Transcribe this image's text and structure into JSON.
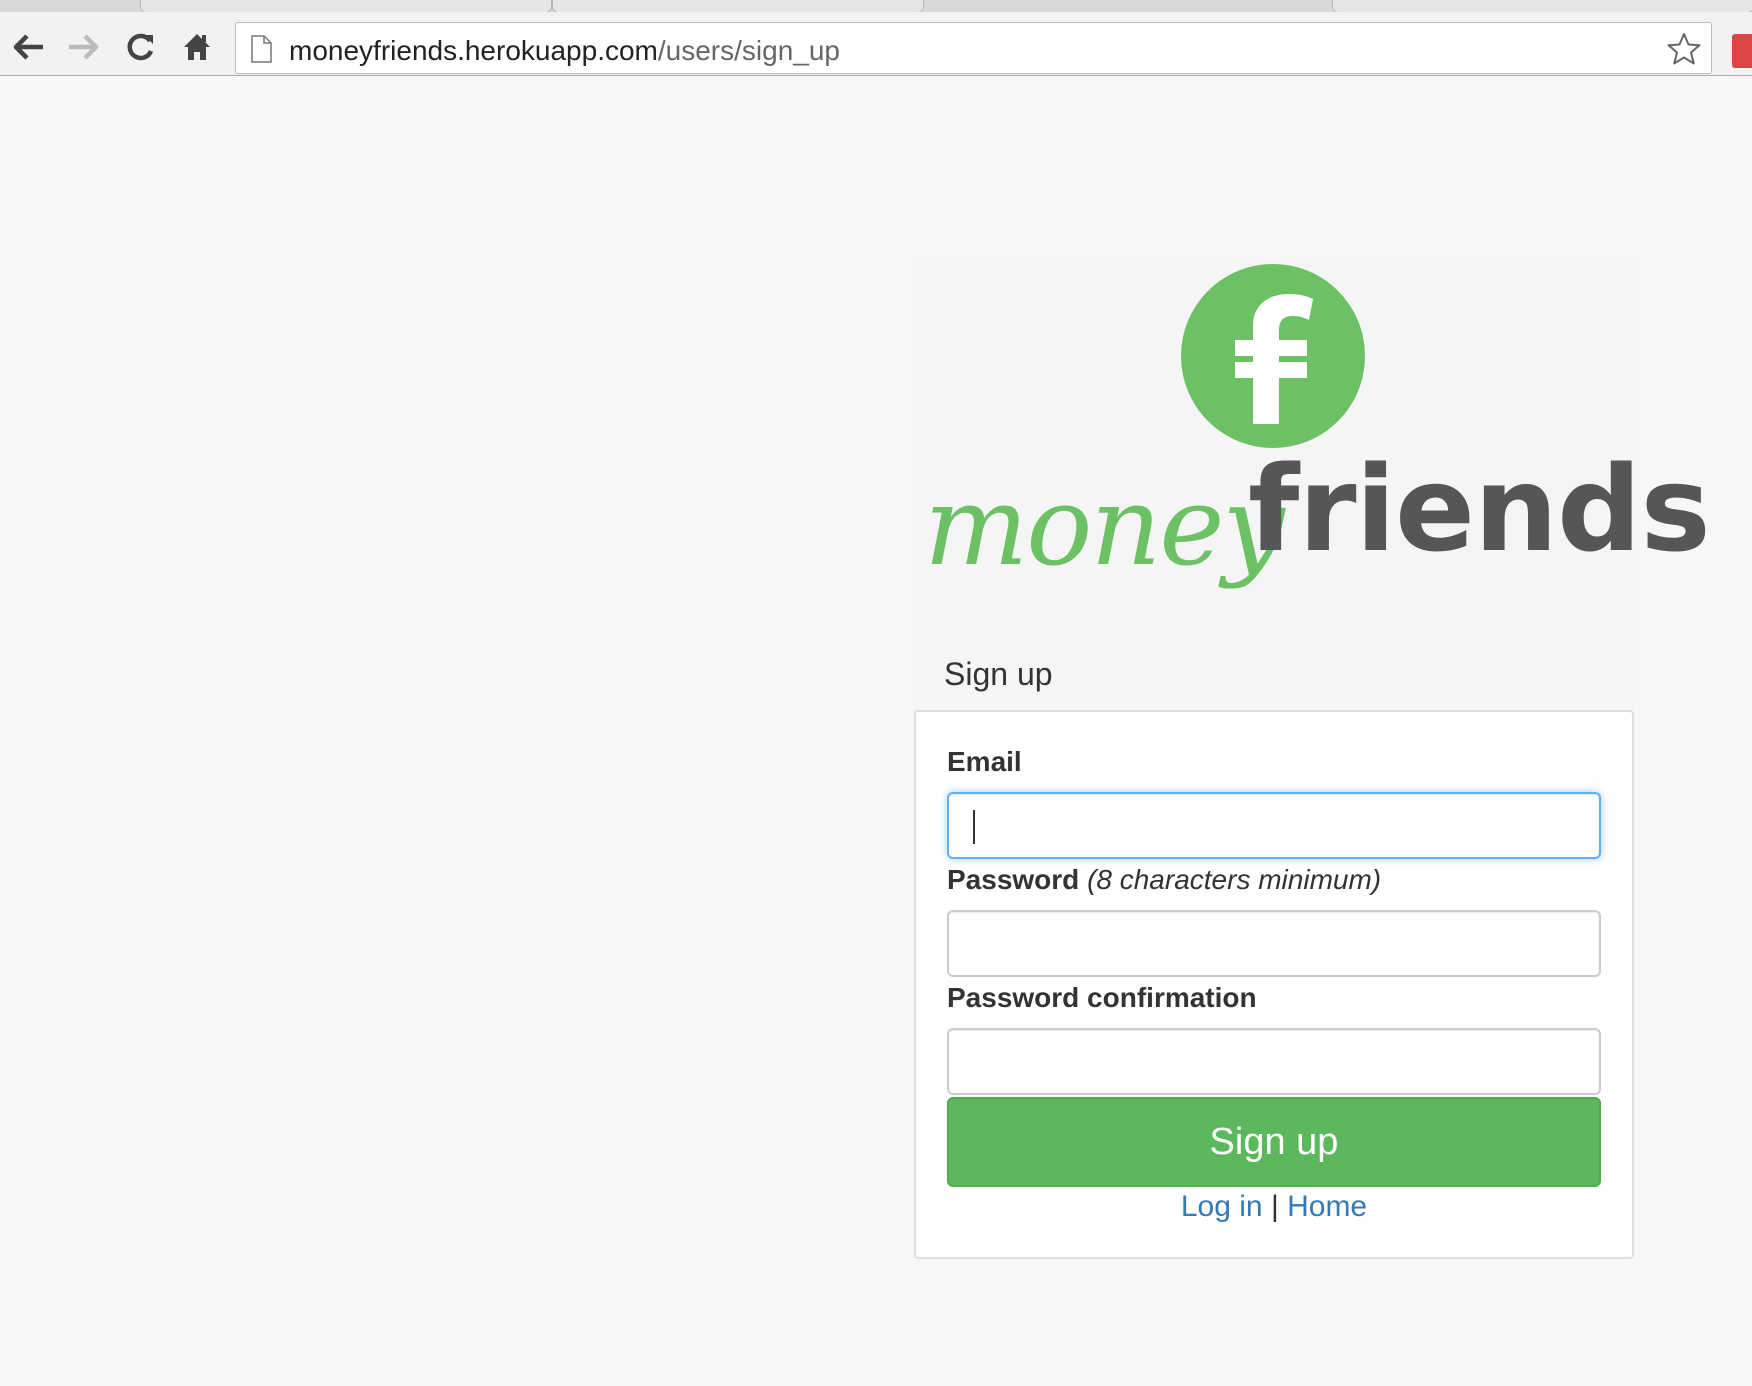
{
  "browser": {
    "url_host": "moneyfriends.herokuapp.com",
    "url_path": "/users/sign_up"
  },
  "logo": {
    "money": "money",
    "friends": "friends",
    "mark": "f"
  },
  "panel": {
    "heading": "Sign up"
  },
  "form": {
    "email_label": "Email",
    "email_value": "",
    "password_label": "Password",
    "password_hint": "(8 characters minimum)",
    "password_value": "",
    "confirmation_label": "Password confirmation",
    "confirmation_value": "",
    "submit_label": "Sign up"
  },
  "links": {
    "login": "Log in",
    "separator": "|",
    "home": "Home"
  },
  "colors": {
    "brand_green": "#6cc165",
    "button_green": "#5cb85c",
    "link_blue": "#337ab7",
    "wordmark_gray": "#555658"
  }
}
